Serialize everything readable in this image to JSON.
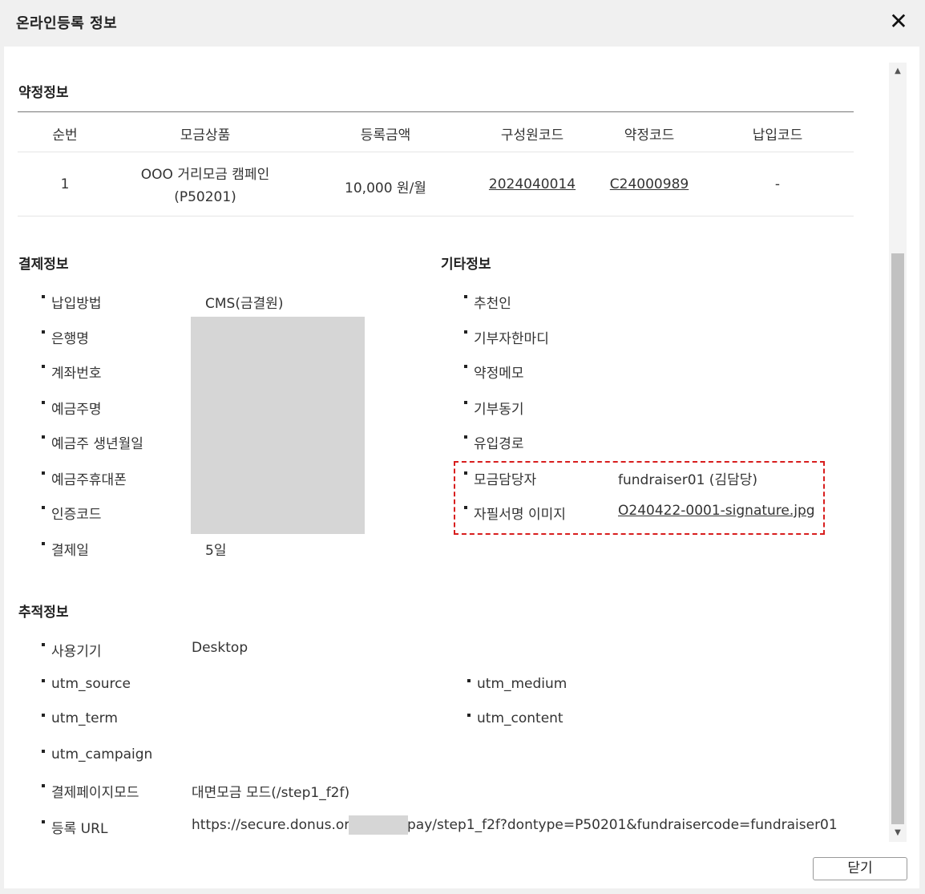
{
  "dialog": {
    "title": "온라인등록 정보",
    "close_label": "✕",
    "footer_button": "닫기"
  },
  "pledge": {
    "section_title": "약정정보",
    "columns": [
      "순번",
      "모금상품",
      "등록금액",
      "구성원코드",
      "약정코드",
      "납입코드"
    ],
    "row": {
      "index": "1",
      "product_name": "OOO 거리모금 캠페인",
      "product_code": "(P50201)",
      "amount": "10,000 원/월",
      "member_code": "2024040014",
      "pledge_code": "C24000989",
      "payment_code": "-"
    }
  },
  "payment": {
    "section_title": "결제정보",
    "items": [
      {
        "label": "납입방법",
        "value": "CMS(금결원)"
      },
      {
        "label": "은행명",
        "value": ""
      },
      {
        "label": "계좌번호",
        "value": ""
      },
      {
        "label": "예금주명",
        "value": ""
      },
      {
        "label": "예금주 생년월일",
        "value": ""
      },
      {
        "label": "예금주휴대폰",
        "value": ""
      },
      {
        "label": "인증코드",
        "value": ""
      },
      {
        "label": "결제일",
        "value": "5일"
      }
    ]
  },
  "other": {
    "section_title": "기타정보",
    "items": [
      {
        "label": "추천인",
        "value": ""
      },
      {
        "label": "기부자한마디",
        "value": ""
      },
      {
        "label": "약정메모",
        "value": ""
      },
      {
        "label": "기부동기",
        "value": ""
      },
      {
        "label": "유입경로",
        "value": ""
      },
      {
        "label": "모금담당자",
        "value": "fundraiser01 (김담당)"
      },
      {
        "label": "자필서명 이미지",
        "value": "O240422-0001-signature.jpg"
      }
    ]
  },
  "tracking": {
    "section_title": "추적정보",
    "device_label": "사용기기",
    "device_value": "Desktop",
    "utm_source_label": "utm_source",
    "utm_medium_label": "utm_medium",
    "utm_term_label": "utm_term",
    "utm_content_label": "utm_content",
    "utm_campaign_label": "utm_campaign",
    "mode_label": "결제페이지모드",
    "mode_value": "대면모금 모드(/step1_f2f)",
    "url_label": "등록 URL",
    "url_prefix": "https://secure.donus.org,",
    "url_suffix": "pay/step1_f2f?dontype=P50201&fundraisercode=fundraiser01"
  },
  "colors": {
    "highlight": "#d81e1e",
    "mask": "#d6d6d6"
  }
}
